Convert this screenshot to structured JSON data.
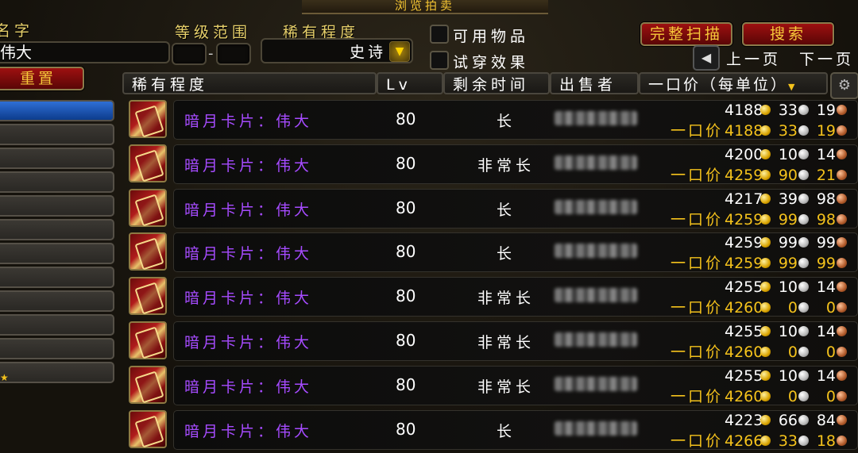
{
  "window": {
    "title": "浏览拍卖"
  },
  "filters": {
    "name_label": "名字",
    "name_value": "伟大",
    "level_label": "等级范围",
    "level_dash": "-",
    "rarity_label": "稀有程度",
    "rarity_value": "史诗",
    "usable_label": "可用物品",
    "preview_label": "试穿效果",
    "reset_label": "重置"
  },
  "buttons": {
    "full_scan": "完整扫描",
    "search": "搜索",
    "prev_page": "上一页",
    "next_page": "下一页"
  },
  "columns": {
    "rarity": "稀有程度",
    "level": "Lv",
    "time_left": "剩余时间",
    "seller": "出售者",
    "buyout": "一口价（每单位）"
  },
  "buyout_prefix": "一口价",
  "rows": [
    {
      "name": "暗月卡片：伟大",
      "level": "80",
      "time": "长",
      "bid": {
        "g": "4188",
        "s": "33",
        "c": "19"
      },
      "buyout": {
        "g": "4188",
        "s": "33",
        "c": "19"
      }
    },
    {
      "name": "暗月卡片：伟大",
      "level": "80",
      "time": "非常长",
      "bid": {
        "g": "4200",
        "s": "10",
        "c": "14"
      },
      "buyout": {
        "g": "4259",
        "s": "90",
        "c": "21"
      }
    },
    {
      "name": "暗月卡片：伟大",
      "level": "80",
      "time": "长",
      "bid": {
        "g": "4217",
        "s": "39",
        "c": "98"
      },
      "buyout": {
        "g": "4259",
        "s": "99",
        "c": "98"
      }
    },
    {
      "name": "暗月卡片：伟大",
      "level": "80",
      "time": "长",
      "bid": {
        "g": "4259",
        "s": "99",
        "c": "99"
      },
      "buyout": {
        "g": "4259",
        "s": "99",
        "c": "99"
      }
    },
    {
      "name": "暗月卡片：伟大",
      "level": "80",
      "time": "非常长",
      "bid": {
        "g": "4255",
        "s": "10",
        "c": "14"
      },
      "buyout": {
        "g": "4260",
        "s": "0",
        "c": "0"
      }
    },
    {
      "name": "暗月卡片：伟大",
      "level": "80",
      "time": "非常长",
      "bid": {
        "g": "4255",
        "s": "10",
        "c": "14"
      },
      "buyout": {
        "g": "4260",
        "s": "0",
        "c": "0"
      }
    },
    {
      "name": "暗月卡片：伟大",
      "level": "80",
      "time": "非常长",
      "bid": {
        "g": "4255",
        "s": "10",
        "c": "14"
      },
      "buyout": {
        "g": "4260",
        "s": "0",
        "c": "0"
      }
    },
    {
      "name": "暗月卡片：伟大",
      "level": "80",
      "time": "长",
      "bid": {
        "g": "4223",
        "s": "66",
        "c": "84"
      },
      "buyout": {
        "g": "4266",
        "s": "33",
        "c": "18"
      }
    }
  ],
  "colors": {
    "epic": "#a64bff",
    "gold_text": "#f4c21c",
    "button_red": "#9d1010"
  },
  "icons": {
    "item": "darkmoon-card-icon",
    "settings": "gear-icon",
    "sort": "sort-arrow-icon"
  }
}
